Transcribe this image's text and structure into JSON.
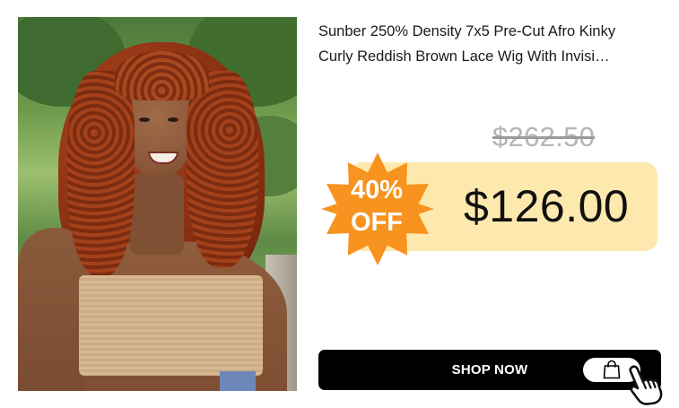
{
  "product": {
    "title": "Sunber 250% Density 7x5 Pre-Cut Afro Kinky Curly Reddish Brown Lace Wig With Invisi…",
    "image_icon": "product-photo"
  },
  "pricing": {
    "original_price": "$262.50",
    "sale_price": "$126.00",
    "discount_percent": "40%",
    "discount_label": "OFF"
  },
  "cta": {
    "label": "SHOP NOW",
    "bag_icon": "shopping-bag-icon",
    "cursor_icon": "pointing-hand-icon"
  },
  "colors": {
    "badge": "#f7931e",
    "price_box": "#fde9ad",
    "button": "#000000",
    "strike_price": "#b5b5b5"
  }
}
